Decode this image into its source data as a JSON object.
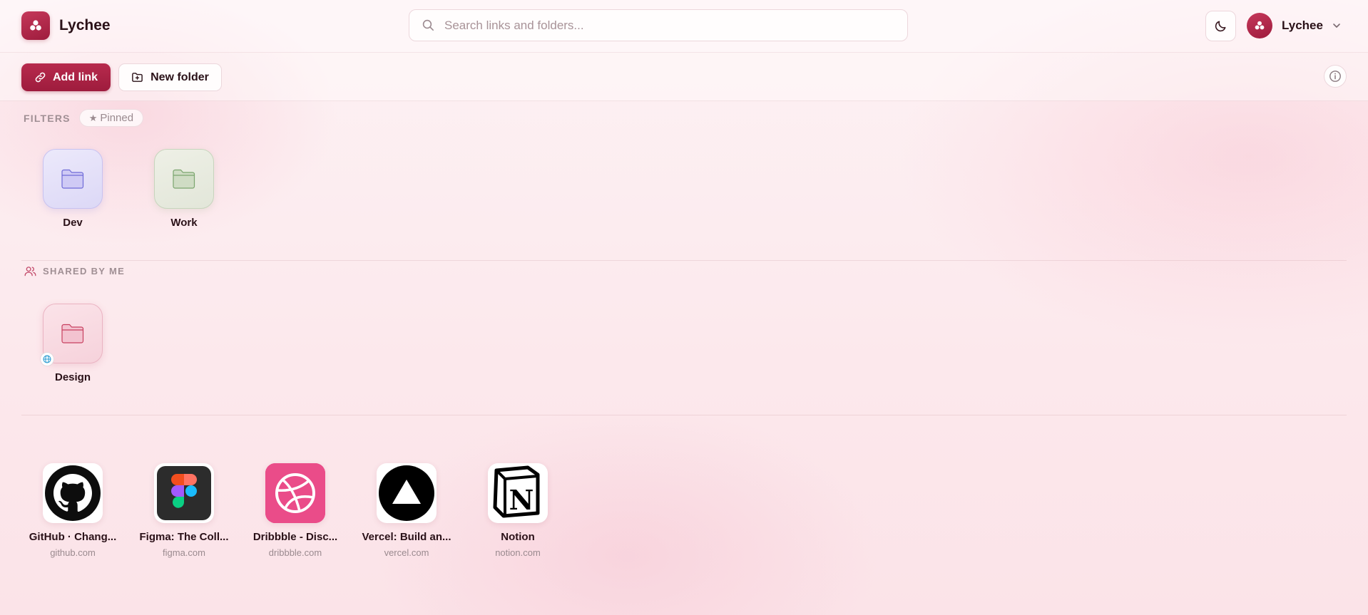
{
  "app": {
    "name": "Lychee"
  },
  "search": {
    "placeholder": "Search links and folders..."
  },
  "user": {
    "name": "Lychee"
  },
  "toolbar": {
    "add_link": "Add link",
    "new_folder": "New folder"
  },
  "filters": {
    "label": "FILTERS",
    "chips": [
      "Pinned"
    ]
  },
  "folders": [
    {
      "name": "Dev",
      "color": "#6f6bd8"
    },
    {
      "name": "Work",
      "color": "#7aa56d"
    }
  ],
  "shared": {
    "label": "SHARED BY ME",
    "folders": [
      {
        "name": "Design",
        "color": "#c8405f",
        "public": true
      }
    ]
  },
  "links": [
    {
      "title": "GitHub · Chang...",
      "domain": "github.com",
      "icon": "github-icon"
    },
    {
      "title": "Figma: The Coll...",
      "domain": "figma.com",
      "icon": "figma-icon"
    },
    {
      "title": "Dribbble - Disc...",
      "domain": "dribbble.com",
      "icon": "dribbble-icon"
    },
    {
      "title": "Vercel: Build an...",
      "domain": "vercel.com",
      "icon": "vercel-icon"
    },
    {
      "title": "Notion",
      "domain": "notion.com",
      "icon": "notion-icon"
    }
  ],
  "colors": {
    "brand": "#a8234a",
    "background": "#fcebee"
  }
}
